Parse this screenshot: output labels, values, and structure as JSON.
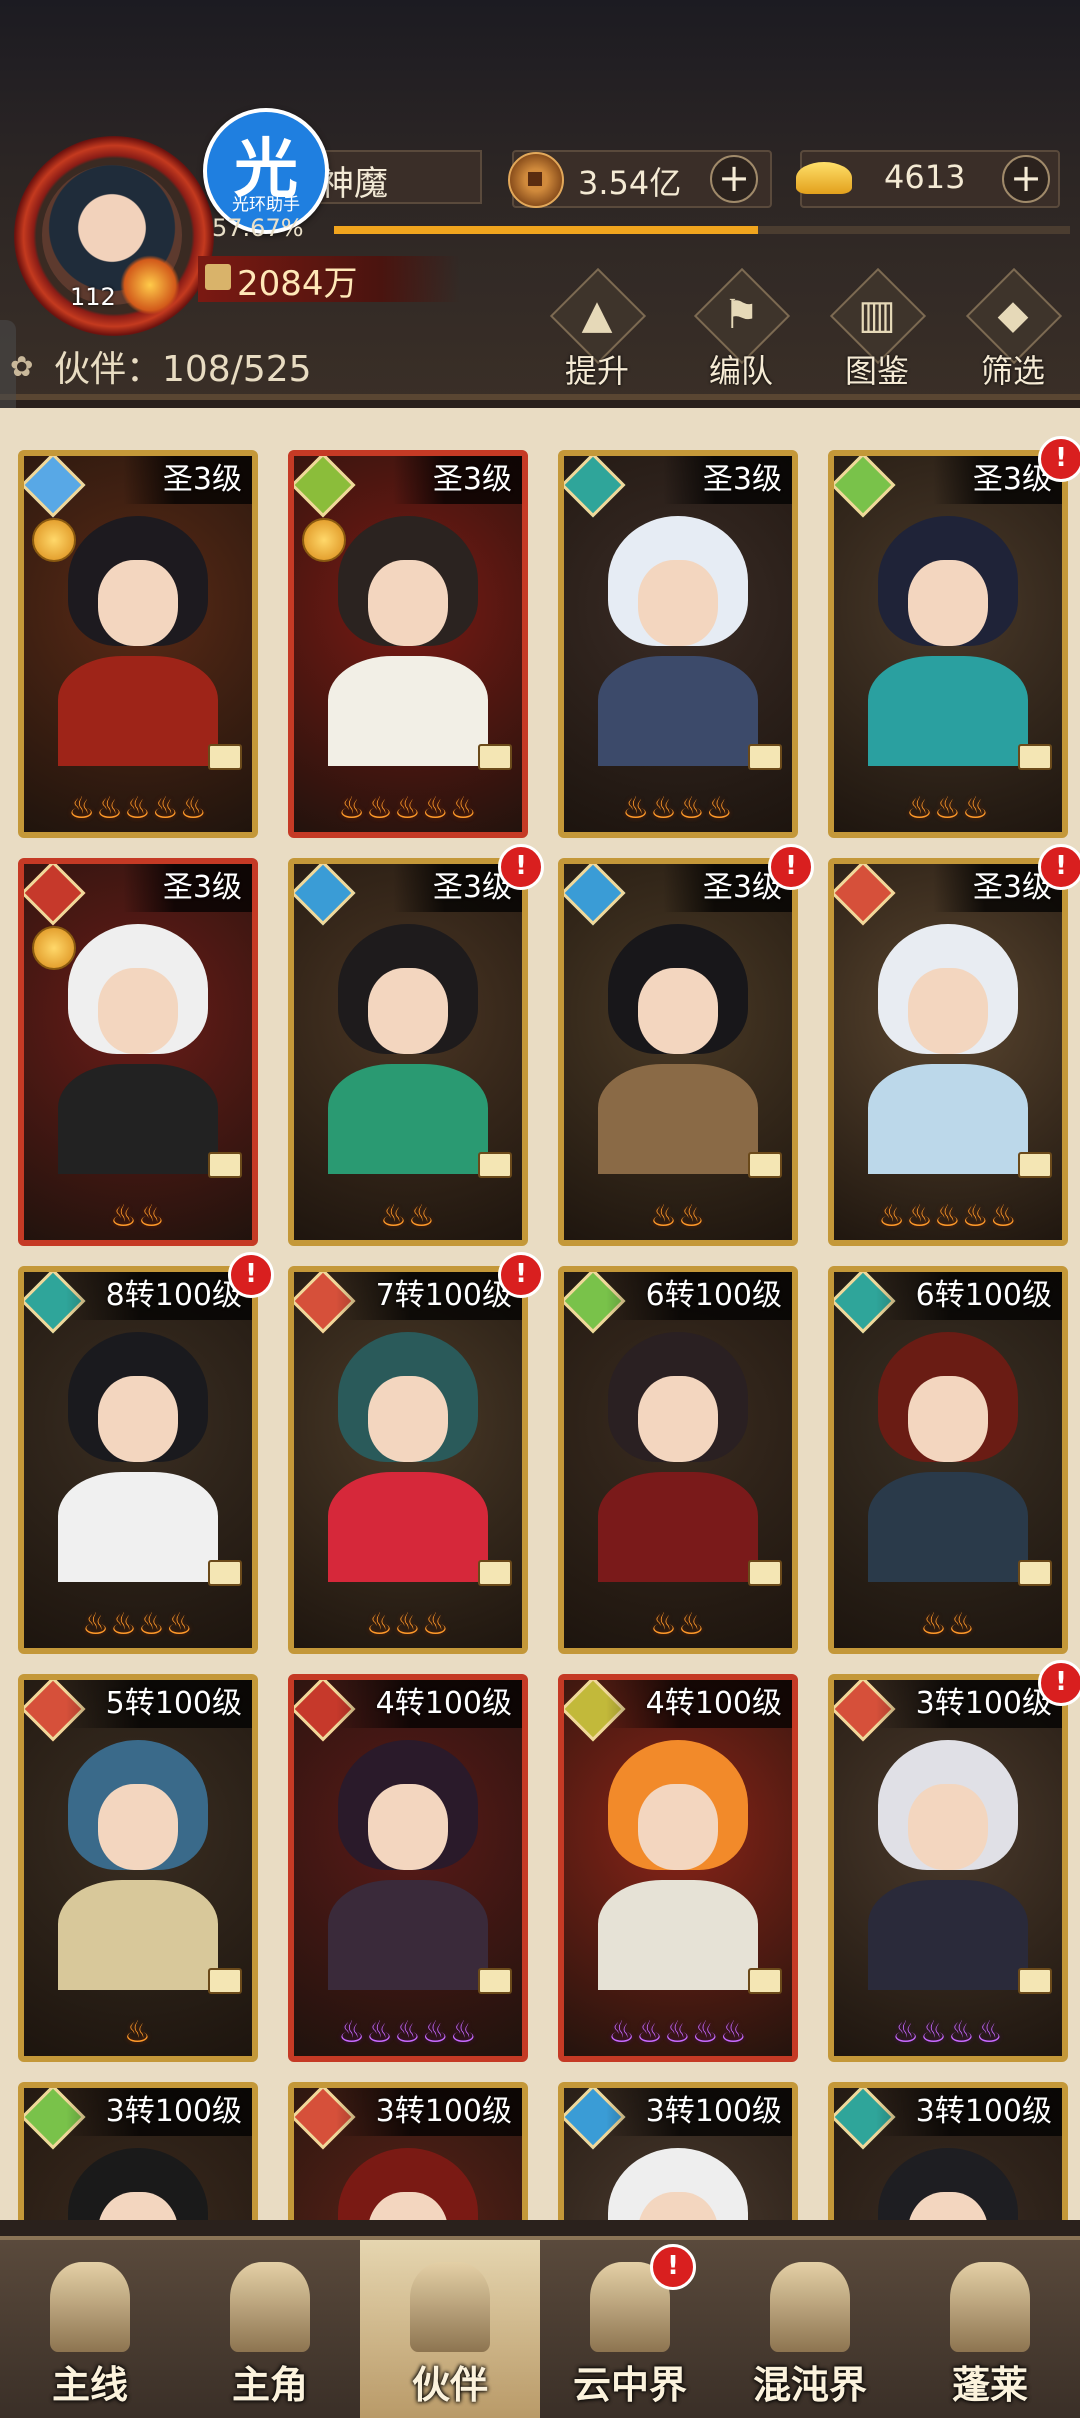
{
  "player": {
    "name": "神魔",
    "level": "112",
    "xp_percent_text": "57.67%",
    "xp_fraction": 0.5767,
    "power": "2084万"
  },
  "overlay_badge": {
    "glyph": "光",
    "text": "光环助手"
  },
  "resources": {
    "coins": "3.54亿",
    "ingots": "4613",
    "plus_glyph": "+"
  },
  "partners": {
    "label": "伙伴：108/525"
  },
  "actions": [
    {
      "label": "提升",
      "icon": "upgrade-icon",
      "glyph": "▲"
    },
    {
      "label": "编队",
      "icon": "formation-icon",
      "glyph": "⚑"
    },
    {
      "label": "图鉴",
      "icon": "codex-icon",
      "glyph": "▥"
    },
    {
      "label": "筛选",
      "icon": "filter-icon",
      "glyph": "◆"
    }
  ],
  "cards": [
    {
      "level": "圣3级",
      "stars": "♨♨♨♨♨",
      "star_color": "orange",
      "element": "#58a8e6",
      "hair": "#1d1a1f",
      "outfit": "#9e2418",
      "bg": "#5a2a16",
      "border": "gold",
      "alert": false,
      "sub_icon": true
    },
    {
      "level": "圣3级",
      "stars": "♨♨♨♨♨",
      "star_color": "orange",
      "element": "#8bbd3a",
      "hair": "#2b2320",
      "outfit": "#f2efe6",
      "bg": "#7a1a14",
      "border": "red",
      "alert": false,
      "sub_icon": true
    },
    {
      "level": "圣3级",
      "stars": "♨♨♨♨",
      "star_color": "orange",
      "element": "#2fa59a",
      "hair": "#e6ecf4",
      "outfit": "#3c4a6a",
      "bg": "#3a2c26",
      "border": "gold",
      "alert": false,
      "sub_icon": false
    },
    {
      "level": "圣3级",
      "stars": "♨♨♨",
      "star_color": "orange",
      "element": "#79c24a",
      "hair": "#1f2338",
      "outfit": "#2aa0a0",
      "bg": "#4a3a2a",
      "border": "gold",
      "alert": true,
      "sub_icon": false
    },
    {
      "level": "圣3级",
      "stars": "♨♨",
      "star_color": "orange",
      "element": "#c6392b",
      "hair": "#efefef",
      "outfit": "#222222",
      "bg": "#6a1c18",
      "border": "red",
      "alert": false,
      "sub_icon": true
    },
    {
      "level": "圣3级",
      "stars": "♨♨",
      "star_color": "orange",
      "element": "#3a9cd6",
      "hair": "#1e1b1c",
      "outfit": "#2a9a72",
      "bg": "#4a3624",
      "border": "gold",
      "alert": true,
      "sub_icon": false
    },
    {
      "level": "圣3级",
      "stars": "♨♨",
      "star_color": "orange",
      "element": "#3a9cd6",
      "hair": "#18171a",
      "outfit": "#8a6a46",
      "bg": "#4a3a26",
      "border": "gold",
      "alert": true,
      "sub_icon": false
    },
    {
      "level": "圣3级",
      "stars": "♨♨♨♨♨",
      "star_color": "orange",
      "element": "#d6503a",
      "hair": "#e8ecf2",
      "outfit": "#bcd8ea",
      "bg": "#5a4630",
      "border": "gold",
      "alert": true,
      "sub_icon": false
    },
    {
      "level": "8转100级",
      "stars": "♨♨♨♨",
      "star_color": "orange",
      "element": "#2fa59a",
      "hair": "#1a1a1e",
      "outfit": "#f0f0f0",
      "bg": "#3a2e22",
      "border": "gold",
      "alert": true,
      "sub_icon": false
    },
    {
      "level": "7转100级",
      "stars": "♨♨♨",
      "star_color": "orange",
      "element": "#d6503a",
      "hair": "#2a5a5a",
      "outfit": "#d6283a",
      "bg": "#4a3a28",
      "border": "gold",
      "alert": true,
      "sub_icon": false
    },
    {
      "level": "6转100级",
      "stars": "♨♨",
      "star_color": "orange",
      "element": "#79c24a",
      "hair": "#2a2022",
      "outfit": "#7a1a1a",
      "bg": "#3a2c20",
      "border": "gold",
      "alert": false,
      "sub_icon": false
    },
    {
      "level": "6转100级",
      "stars": "♨♨",
      "star_color": "orange",
      "element": "#2fa59a",
      "hair": "#6a1c14",
      "outfit": "#2a3a4a",
      "bg": "#3a3024",
      "border": "gold",
      "alert": false,
      "sub_icon": false
    },
    {
      "level": "5转100级",
      "stars": "♨",
      "star_color": "orange",
      "element": "#d6503a",
      "hair": "#3a6a8a",
      "outfit": "#d8c89a",
      "bg": "#3a2e22",
      "border": "gold",
      "alert": false,
      "sub_icon": false
    },
    {
      "level": "4转100级",
      "stars": "♨♨♨♨♨",
      "star_color": "purple",
      "element": "#c6392b",
      "hair": "#2a1a2a",
      "outfit": "#3a2a3a",
      "bg": "#5a1a18",
      "border": "red",
      "alert": false,
      "sub_icon": false
    },
    {
      "level": "4转100级",
      "stars": "♨♨♨♨♨",
      "star_color": "purple",
      "element": "#c2b93a",
      "hair": "#f28a2a",
      "outfit": "#e6e2d6",
      "bg": "#8a2418",
      "border": "red",
      "alert": false,
      "sub_icon": false
    },
    {
      "level": "3转100级",
      "stars": "♨♨♨♨",
      "star_color": "purple",
      "element": "#d6503a",
      "hair": "#e0e0e6",
      "outfit": "#2a2a3a",
      "bg": "#4a3a2c",
      "border": "gold",
      "alert": true,
      "sub_icon": false
    },
    {
      "level": "3转100级",
      "stars": "",
      "star_color": "orange",
      "element": "#79c24a",
      "hair": "#1a1a1a",
      "outfit": "#5a2a1a",
      "bg": "#3a2a1e",
      "border": "gold",
      "alert": false,
      "sub_icon": false
    },
    {
      "level": "3转100级",
      "stars": "",
      "star_color": "orange",
      "element": "#d6503a",
      "hair": "#7a1a14",
      "outfit": "#5a2a1a",
      "bg": "#5a2218",
      "border": "gold",
      "alert": false,
      "sub_icon": false
    },
    {
      "level": "3转100级",
      "stars": "",
      "star_color": "orange",
      "element": "#3a9cd6",
      "hair": "#eeeeee",
      "outfit": "#cfd8e0",
      "bg": "#4a3a2e",
      "border": "gold",
      "alert": false,
      "sub_icon": false
    },
    {
      "level": "3转100级",
      "stars": "",
      "star_color": "orange",
      "element": "#2fa59a",
      "hair": "#1e1e22",
      "outfit": "#4a2a1a",
      "bg": "#3a2c22",
      "border": "gold",
      "alert": false,
      "sub_icon": false
    }
  ],
  "nav": [
    {
      "label": "主线",
      "icon": "main-quest-icon",
      "active": false,
      "alert": false
    },
    {
      "label": "主角",
      "icon": "hero-icon",
      "active": false,
      "alert": false
    },
    {
      "label": "伙伴",
      "icon": "partner-icon",
      "active": true,
      "alert": false
    },
    {
      "label": "云中界",
      "icon": "cloud-realm-icon",
      "active": false,
      "alert": true
    },
    {
      "label": "混沌界",
      "icon": "chaos-realm-icon",
      "active": false,
      "alert": false
    },
    {
      "label": "蓬莱",
      "icon": "penglai-icon",
      "active": false,
      "alert": false
    }
  ],
  "alert_glyph": "!"
}
